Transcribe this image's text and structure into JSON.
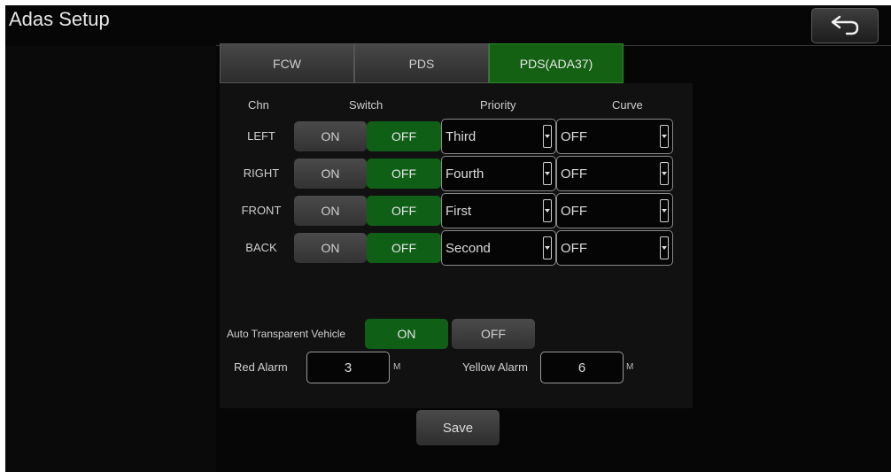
{
  "window": {
    "title": "Adas Setup"
  },
  "tabs": [
    {
      "label": "FCW"
    },
    {
      "label": "PDS"
    },
    {
      "label": "PDS(ADA37)",
      "active": true
    }
  ],
  "table": {
    "headers": {
      "chn": "Chn",
      "switch": "Switch",
      "priority": "Priority",
      "curve": "Curve"
    },
    "rows": [
      {
        "chn": "LEFT",
        "on": "ON",
        "off": "OFF",
        "selected": "off",
        "priority": "Third",
        "curve": "OFF"
      },
      {
        "chn": "RIGHT",
        "on": "ON",
        "off": "OFF",
        "selected": "off",
        "priority": "Fourth",
        "curve": "OFF"
      },
      {
        "chn": "FRONT",
        "on": "ON",
        "off": "OFF",
        "selected": "off",
        "priority": "First",
        "curve": "OFF"
      },
      {
        "chn": "BACK",
        "on": "ON",
        "off": "OFF",
        "selected": "off",
        "priority": "Second",
        "curve": "OFF"
      }
    ]
  },
  "auto_transparent": {
    "label": "Auto Transparent Vehicle",
    "on": "ON",
    "off": "OFF",
    "selected": "on"
  },
  "alarms": {
    "red": {
      "label": "Red Alarm",
      "value": "3",
      "unit": "M"
    },
    "yellow": {
      "label": "Yellow Alarm",
      "value": "6",
      "unit": "M"
    }
  },
  "actions": {
    "save": "Save"
  },
  "colors": {
    "active_green": "#0f5f17",
    "background": "#060606"
  },
  "icons": {
    "back": "back-arrow-icon",
    "dropdown": "chevron-down-icon"
  }
}
